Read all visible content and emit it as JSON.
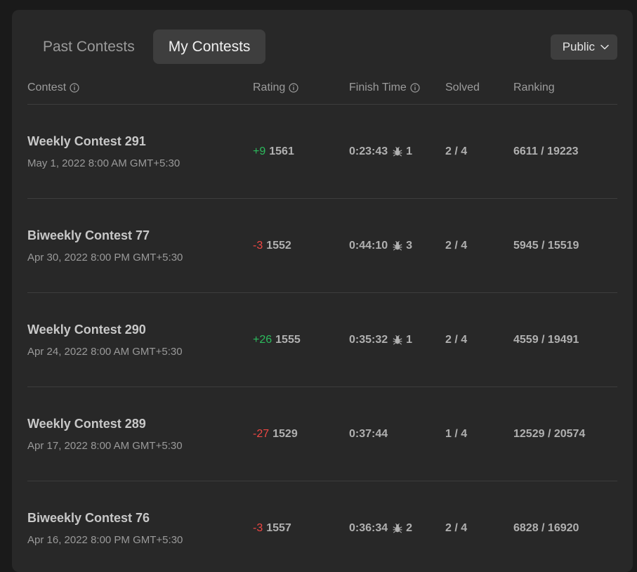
{
  "tabs": [
    {
      "label": "Past Contests"
    },
    {
      "label": "My Contests"
    }
  ],
  "visibility": {
    "label": "Public"
  },
  "columns": {
    "contest": "Contest",
    "rating": "Rating",
    "finish_time": "Finish Time",
    "solved": "Solved",
    "ranking": "Ranking"
  },
  "colors": {
    "positive": "#2cbb5d",
    "negative": "#ef4743",
    "background": "#282828"
  },
  "rows": [
    {
      "name": "Weekly Contest 291",
      "date": "May 1, 2022 8:00 AM GMT+5:30",
      "delta": "+9",
      "rating": "1561",
      "time": "0:23:43",
      "bugs": "1",
      "solved": "2 / 4",
      "ranking": "6611 / 19223"
    },
    {
      "name": "Biweekly Contest 77",
      "date": "Apr 30, 2022 8:00 PM GMT+5:30",
      "delta": "-3",
      "rating": "1552",
      "time": "0:44:10",
      "bugs": "3",
      "solved": "2 / 4",
      "ranking": "5945 / 15519"
    },
    {
      "name": "Weekly Contest 290",
      "date": "Apr 24, 2022 8:00 AM GMT+5:30",
      "delta": "+26",
      "rating": "1555",
      "time": "0:35:32",
      "bugs": "1",
      "solved": "2 / 4",
      "ranking": "4559 / 19491"
    },
    {
      "name": "Weekly Contest 289",
      "date": "Apr 17, 2022 8:00 AM GMT+5:30",
      "delta": "-27",
      "rating": "1529",
      "time": "0:37:44",
      "bugs": "",
      "solved": "1 / 4",
      "ranking": "12529 / 20574"
    },
    {
      "name": "Biweekly Contest 76",
      "date": "Apr 16, 2022 8:00 PM GMT+5:30",
      "delta": "-3",
      "rating": "1557",
      "time": "0:36:34",
      "bugs": "2",
      "solved": "2 / 4",
      "ranking": "6828 / 16920"
    }
  ]
}
